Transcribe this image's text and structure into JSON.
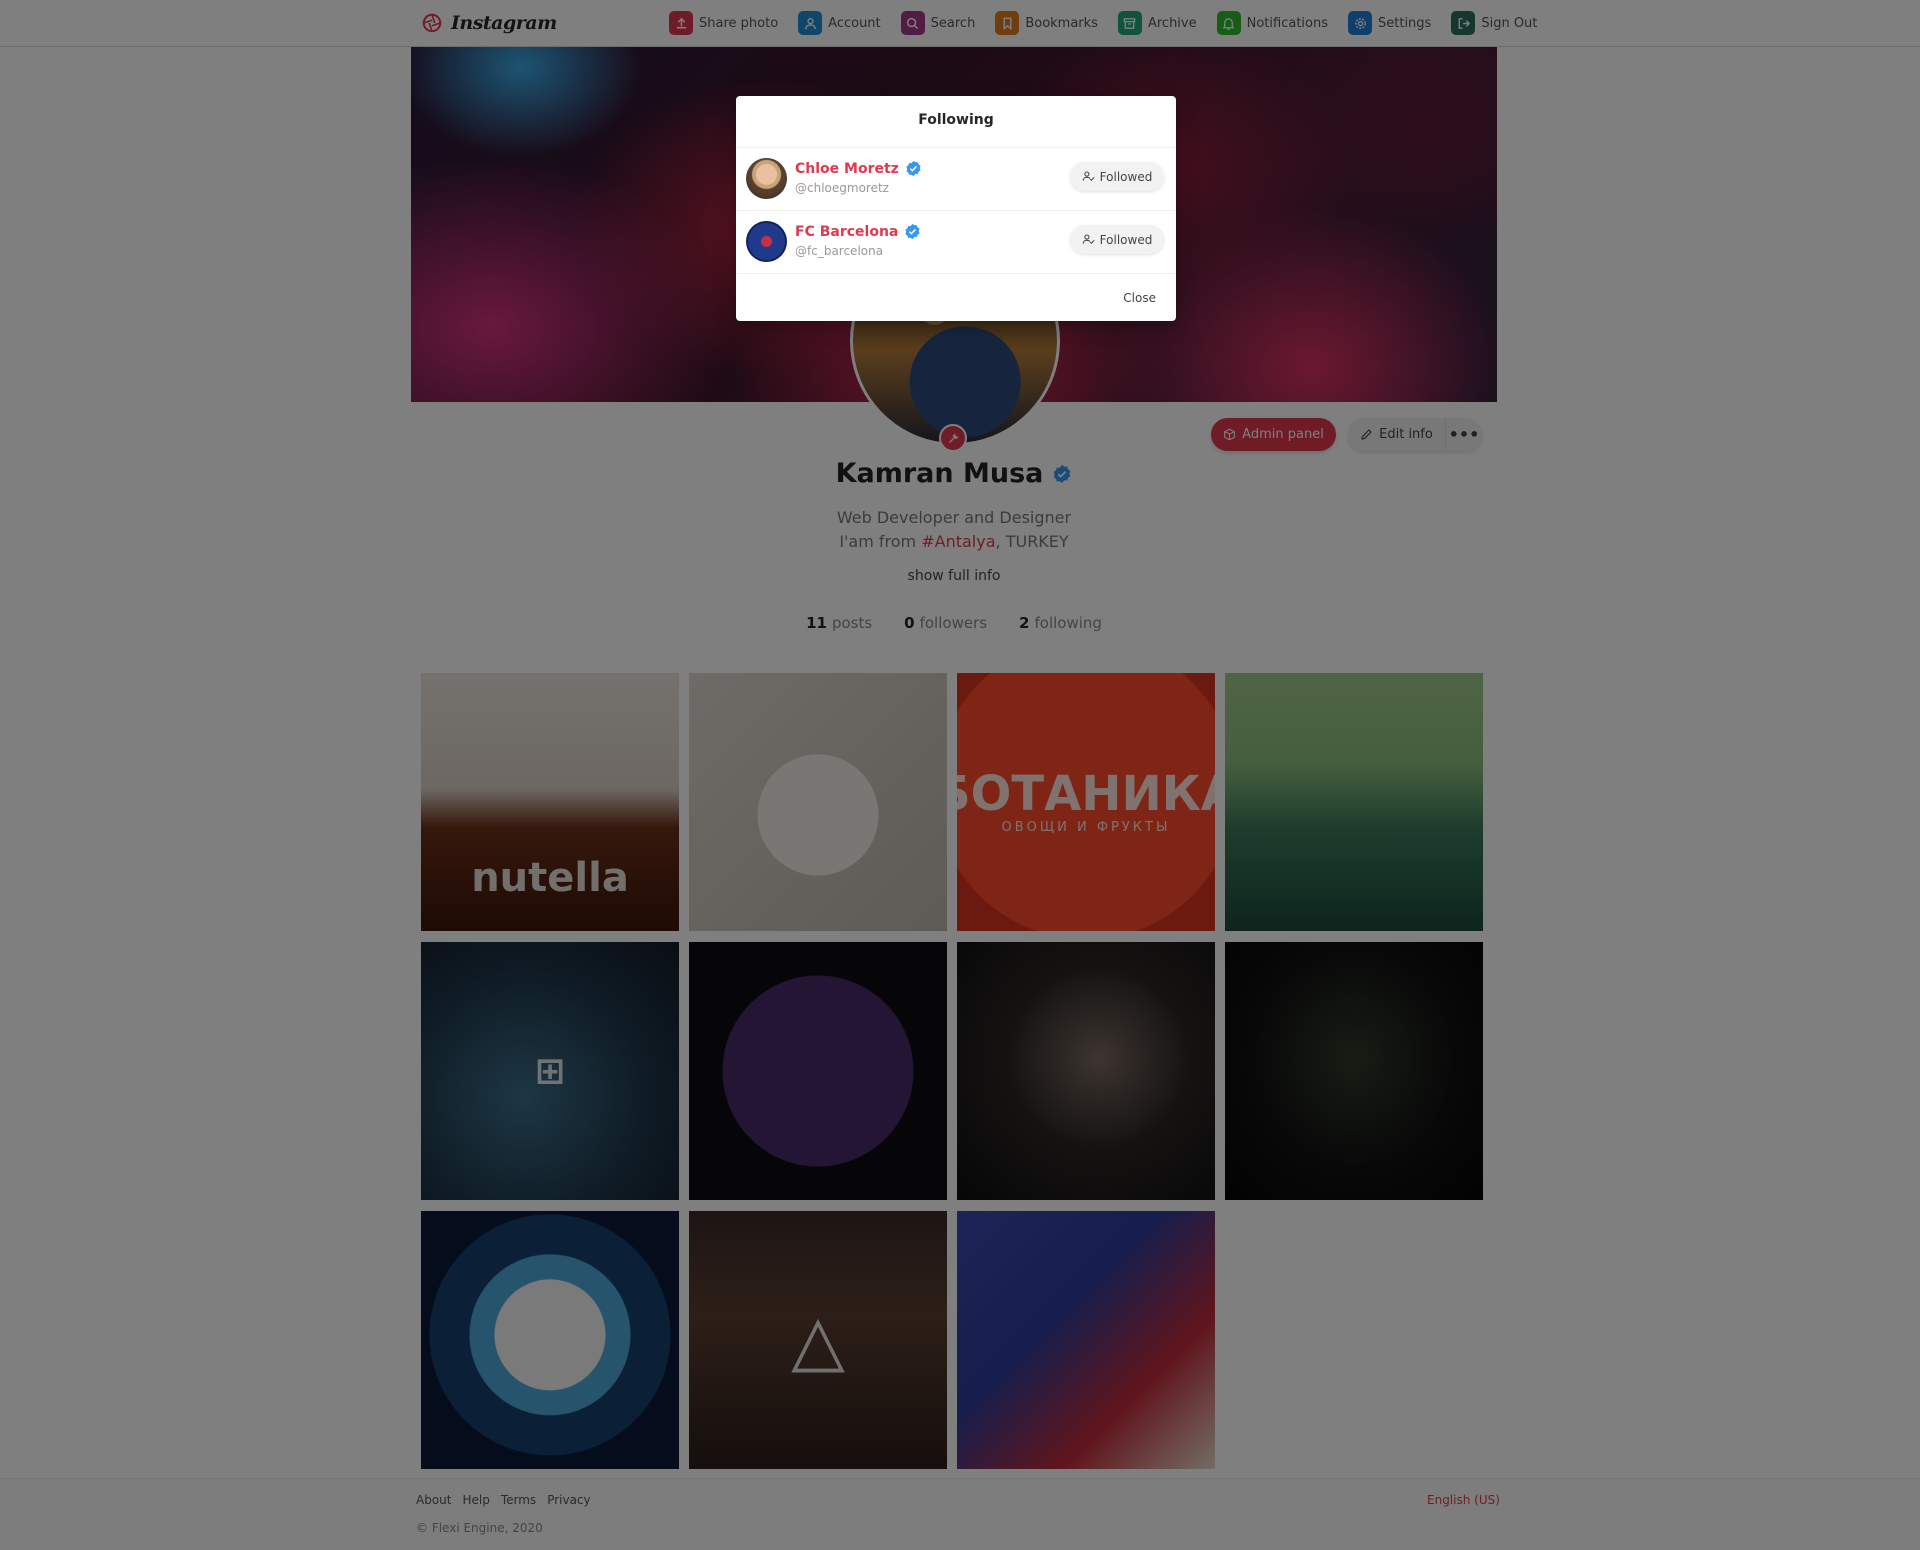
{
  "brand": {
    "name": "Instagram"
  },
  "nav": [
    {
      "label": "Share photo",
      "icon": "upload-icon",
      "color": "#e0394f"
    },
    {
      "label": "Account",
      "icon": "user-icon",
      "color": "#1f8fd4"
    },
    {
      "label": "Search",
      "icon": "search-icon",
      "color": "#a23a8a"
    },
    {
      "label": "Bookmarks",
      "icon": "bookmark-icon",
      "color": "#e07a1f"
    },
    {
      "label": "Archive",
      "icon": "archive-icon",
      "color": "#1fa87a"
    },
    {
      "label": "Notifications",
      "icon": "bell-icon",
      "color": "#2eb82e"
    },
    {
      "label": "Settings",
      "icon": "gear-icon",
      "color": "#1f7fd4"
    },
    {
      "label": "Sign Out",
      "icon": "sign-out-icon",
      "color": "#2a6e5a"
    }
  ],
  "profile": {
    "name": "Kamran Musa",
    "bio_line1": "Web Developer and Designer",
    "bio_line2_prefix": "I'am from ",
    "bio_tag": "#Antalya",
    "bio_line2_suffix": ", TURKEY",
    "show_full": "show full info",
    "posts_count": "11",
    "posts_label": "posts",
    "followers_count": "0",
    "followers_label": "followers",
    "following_count": "2",
    "following_label": "following",
    "admin_label": "Admin panel",
    "edit_label": "Edit info",
    "more_label": "•••"
  },
  "posts": [
    {
      "label": "nutella"
    },
    {
      "label": ""
    },
    {
      "label": "БОТАНИКА",
      "sub": "ОВОЩИ И ФРУКТЫ"
    },
    {
      "label": ""
    },
    {
      "label": "⊞"
    },
    {
      "label": ""
    },
    {
      "label": ""
    },
    {
      "label": ""
    },
    {
      "label": ""
    },
    {
      "label": "△"
    },
    {
      "label": ""
    }
  ],
  "modal": {
    "title": "Following",
    "items": [
      {
        "name": "Chloe Moretz",
        "handle": "@chloegmoretz",
        "button": "Followed"
      },
      {
        "name": "FC Barcelona",
        "handle": "@fc_barcelona",
        "button": "Followed"
      }
    ],
    "close": "Close"
  },
  "footer": {
    "links": [
      "About",
      "Help",
      "Terms",
      "Privacy"
    ],
    "copyright": "© Flexi Engine, 2020",
    "language": "English (US)"
  },
  "colors": {
    "accent": "#e0394f",
    "verified": "#3897f0"
  }
}
